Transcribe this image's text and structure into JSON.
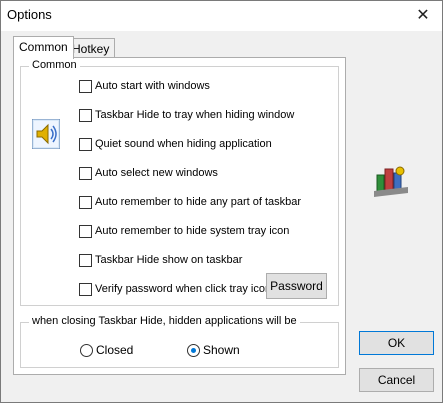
{
  "window": {
    "title": "Options",
    "close_label": "✕"
  },
  "tabs": [
    "Common",
    "Hotkey"
  ],
  "common_group": {
    "label": "Common",
    "checkboxes": [
      "Auto start with windows",
      "Taskbar Hide to tray when hiding window",
      "Quiet sound when hiding application",
      "Auto select new windows",
      "Auto remember to hide any part of taskbar",
      "Auto remember to hide system tray icon",
      "Taskbar Hide show on taskbar",
      "Verify password when click tray icon"
    ],
    "password_button": "Password"
  },
  "closing_group": {
    "label": "when closing Taskbar Hide, hidden applications will be",
    "options": [
      "Closed",
      "Shown"
    ],
    "selected": "Shown"
  },
  "buttons": {
    "ok": "OK",
    "cancel": "Cancel"
  },
  "icons": {
    "left": "speaker-icon",
    "right": "app-icon"
  },
  "colors": {
    "selected_radio": "#0078d7",
    "ok_border": "#0078d7"
  }
}
